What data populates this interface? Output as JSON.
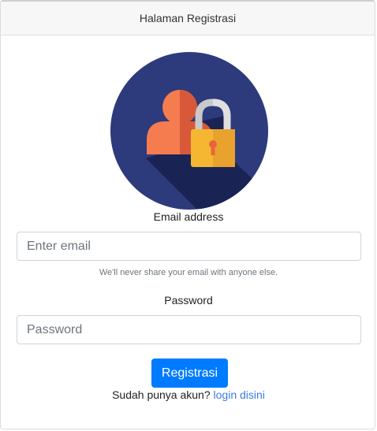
{
  "header": {
    "title": "Halaman Registrasi"
  },
  "form": {
    "email_label": "Email address",
    "email_placeholder": "Enter email",
    "email_help": "We'll never share your email with anyone else.",
    "password_label": "Password",
    "password_placeholder": "Password",
    "submit_label": "Registrasi"
  },
  "footer": {
    "prompt": "Sudah punya akun?",
    "link_label": "login disini"
  },
  "colors": {
    "primary": "#007bff",
    "avatar_bg": "#2d3a7c",
    "link": "#3b7ddd"
  },
  "icons": {
    "avatar": "user-lock-icon"
  }
}
